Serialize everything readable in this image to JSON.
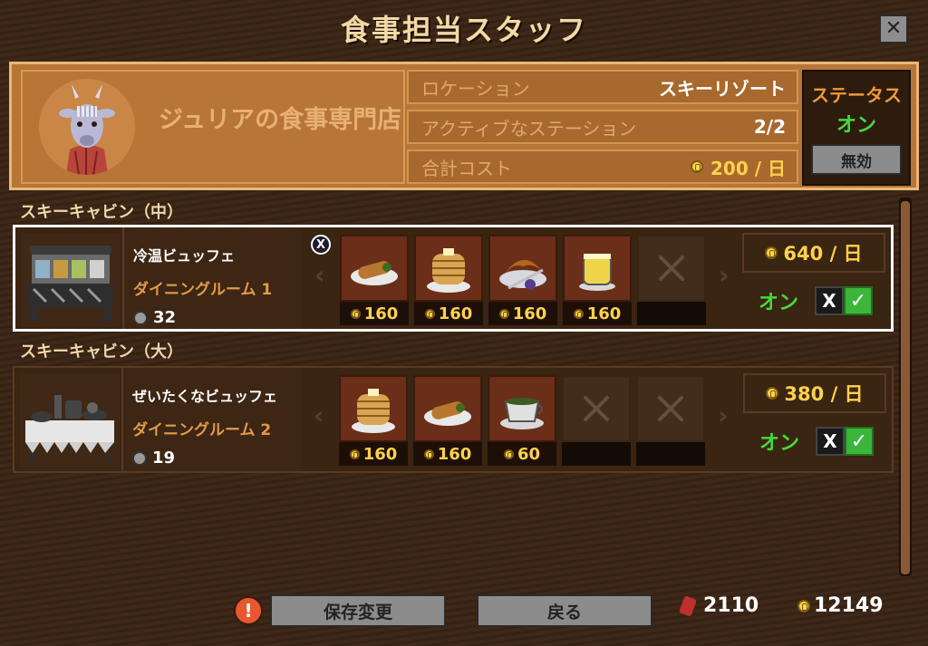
{
  "window": {
    "title": "食事担当スタッフ",
    "close_label": "✕"
  },
  "shop": {
    "name": "ジュリアの食事専門店",
    "location_label": "ロケーション",
    "location_value": "スキーリゾート",
    "active_label": "アクティブなステーション",
    "active_value": "2/2",
    "cost_label": "合計コスト",
    "cost_value": "200 / 日"
  },
  "status": {
    "label": "ステータス",
    "value": "オン",
    "disable_button": "無効"
  },
  "sections": [
    {
      "title": "スキーキャビン（中）",
      "station": {
        "name": "冷温ビュッフェ",
        "room": "ダイニングルーム 1",
        "count": "32",
        "remove_label": "X",
        "cost": "640 / 日",
        "toggle_label": "オン",
        "toggle_off": "X",
        "toggle_on": "✓",
        "slots": [
          {
            "item": "burrito-plate",
            "price": "160"
          },
          {
            "item": "pancake-stack",
            "price": "160"
          },
          {
            "item": "croissant-plate",
            "price": "160"
          },
          {
            "item": "pudding-cup",
            "price": "160"
          }
        ]
      }
    },
    {
      "title": "スキーキャビン（大）",
      "station": {
        "name": "ぜいたくなビュッフェ",
        "room": "ダイニングルーム 2",
        "count": "19",
        "cost": "380 / 日",
        "toggle_label": "オン",
        "toggle_off": "X",
        "toggle_on": "✓",
        "slots": [
          {
            "item": "pancake-stack",
            "price": "160"
          },
          {
            "item": "burrito-plate",
            "price": "160"
          },
          {
            "item": "soup-cup",
            "price": "60"
          }
        ]
      }
    }
  ],
  "footer": {
    "save_button": "保存変更",
    "back_button": "戻る",
    "tickets": "2110",
    "coins": "12149"
  },
  "colors": {
    "accent_gold": "#ffd24a",
    "on_green": "#45d93e",
    "panel": "#b77537"
  }
}
